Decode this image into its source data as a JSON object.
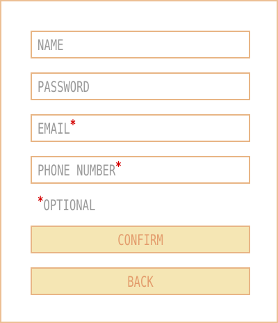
{
  "form": {
    "fields": [
      {
        "label": "NAME",
        "required_mark": ""
      },
      {
        "label": "PASSWORD",
        "required_mark": ""
      },
      {
        "label": "EMAIL",
        "required_mark": "*"
      },
      {
        "label": "PHONE NUMBER",
        "required_mark": "*"
      }
    ],
    "note": {
      "mark": "*",
      "text": "OPTIONAL"
    },
    "buttons": {
      "confirm_label": "CONFIRM",
      "back_label": "BACK"
    }
  },
  "colors": {
    "border": "#e8b585",
    "button_fill": "#f5e6b4",
    "button_text": "#e39c6c",
    "label_text": "#9a9a9a",
    "asterisk": "#d40000"
  }
}
